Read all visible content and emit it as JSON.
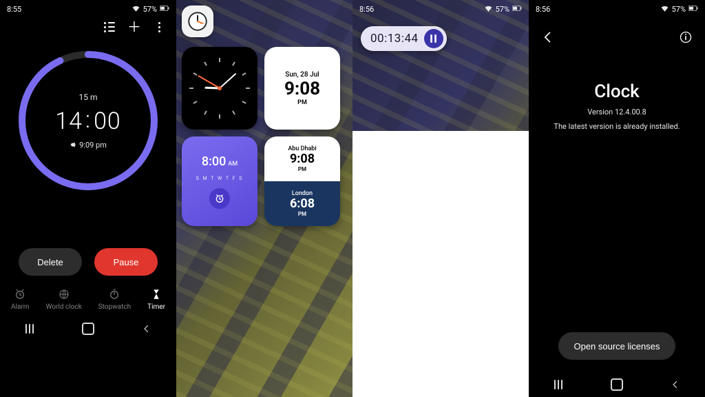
{
  "status": {
    "time_a": "8:55",
    "time_b": "8:56",
    "battery": "57%",
    "battery_icon": "battery-icon",
    "wifi_icon": "wifi-icon"
  },
  "timer": {
    "actions": {
      "list": "list-icon",
      "add": "plus-icon",
      "more": "more-icon"
    },
    "duration_label": "15 m",
    "remaining": {
      "mm": "14",
      "ss": "00"
    },
    "finish_at": "9:09 pm",
    "finish_icon": "bell-icon",
    "progress_pct": 93,
    "delete_label": "Delete",
    "pause_label": "Pause",
    "tabs": {
      "alarm": "Alarm",
      "world": "World clock",
      "stopwatch": "Stopwatch",
      "timer": "Timer"
    }
  },
  "widgets": {
    "app_icon": "clock-app-icon",
    "digital": {
      "date": "Sun, 28 Jul",
      "time": "9:08",
      "ampm": "PM"
    },
    "alarm": {
      "time": "8:00",
      "ampm": "AM",
      "days": "S M T W T F S",
      "icon": "alarm-icon"
    },
    "world": {
      "city1": "Abu Dhabi",
      "time1": "9:08",
      "ampm1": "PM",
      "city2": "London",
      "time2": "6:08",
      "ampm2": "PM"
    }
  },
  "stopwatch_widget": {
    "elapsed": "00:13:44",
    "pause_icon": "pause-icon"
  },
  "about": {
    "back_icon": "back-icon",
    "info_icon": "info-icon",
    "title": "Clock",
    "version": "Version 12.4.00.8",
    "status_msg": "The latest version is already installed.",
    "licenses_label": "Open source licenses"
  },
  "nav": {
    "recents": "recents-icon",
    "home": "home-icon",
    "back": "back-icon"
  }
}
